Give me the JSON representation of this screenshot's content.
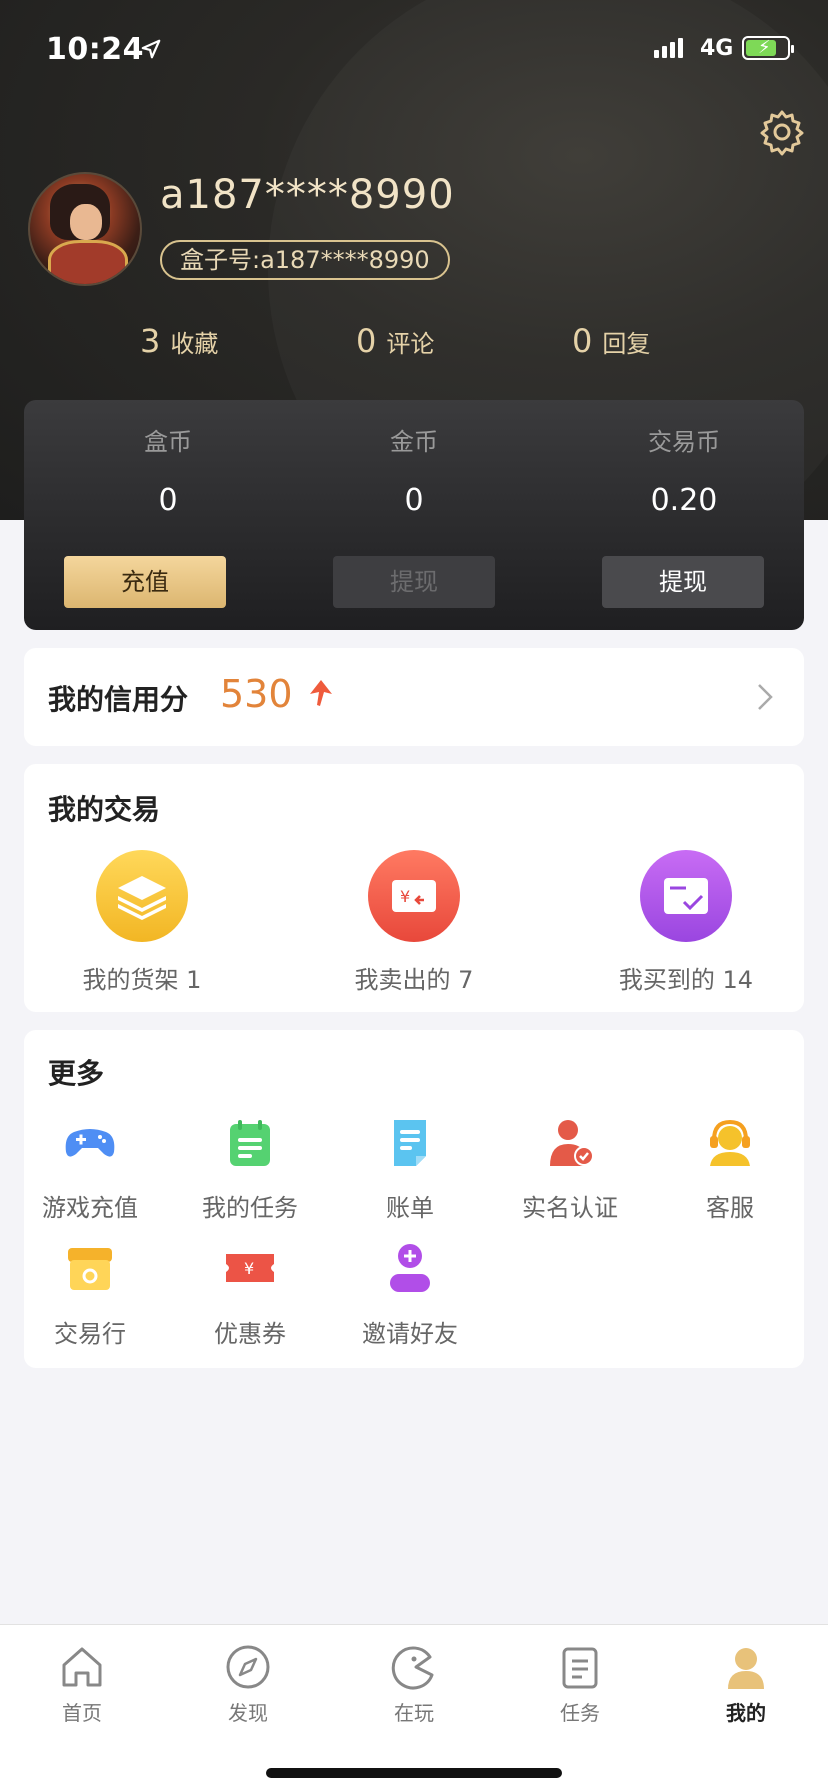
{
  "status_bar": {
    "time": "10:24",
    "network": "4G"
  },
  "profile": {
    "username": "a187****8990",
    "box_id": "盒子号:a187****8990"
  },
  "stats": [
    {
      "value": "3",
      "label": "收藏"
    },
    {
      "value": "0",
      "label": "评论"
    },
    {
      "value": "0",
      "label": "回复"
    }
  ],
  "wallet": {
    "columns": [
      {
        "label": "盒币",
        "value": "0",
        "button": "充值"
      },
      {
        "label": "金币",
        "value": "0",
        "button": "提现"
      },
      {
        "label": "交易币",
        "value": "0.20",
        "button": "提现"
      }
    ]
  },
  "credit": {
    "title": "我的信用分",
    "score": "530"
  },
  "trades": {
    "title": "我的交易",
    "items": [
      {
        "label": "我的货架 1",
        "icon": "stack-icon",
        "color": "#f5c23a"
      },
      {
        "label": "我卖出的 7",
        "icon": "sold-icon",
        "color": "#ef5b4c"
      },
      {
        "label": "我买到的 14",
        "icon": "bought-icon",
        "color": "#a54ee6"
      }
    ]
  },
  "more": {
    "title": "更多",
    "items": [
      {
        "label": "游戏充值",
        "icon": "gamepad-icon"
      },
      {
        "label": "我的任务",
        "icon": "task-icon"
      },
      {
        "label": "账单",
        "icon": "bill-icon"
      },
      {
        "label": "实名认证",
        "icon": "verify-icon"
      },
      {
        "label": "客服",
        "icon": "service-icon"
      },
      {
        "label": "交易行",
        "icon": "market-icon"
      },
      {
        "label": "优惠券",
        "icon": "coupon-icon"
      },
      {
        "label": "邀请好友",
        "icon": "invite-icon"
      }
    ]
  },
  "tabs": [
    {
      "label": "首页",
      "icon": "home-icon"
    },
    {
      "label": "发现",
      "icon": "compass-icon"
    },
    {
      "label": "在玩",
      "icon": "playing-icon"
    },
    {
      "label": "任务",
      "icon": "task-list-icon"
    },
    {
      "label": "我的",
      "icon": "profile-icon",
      "active": true
    }
  ]
}
